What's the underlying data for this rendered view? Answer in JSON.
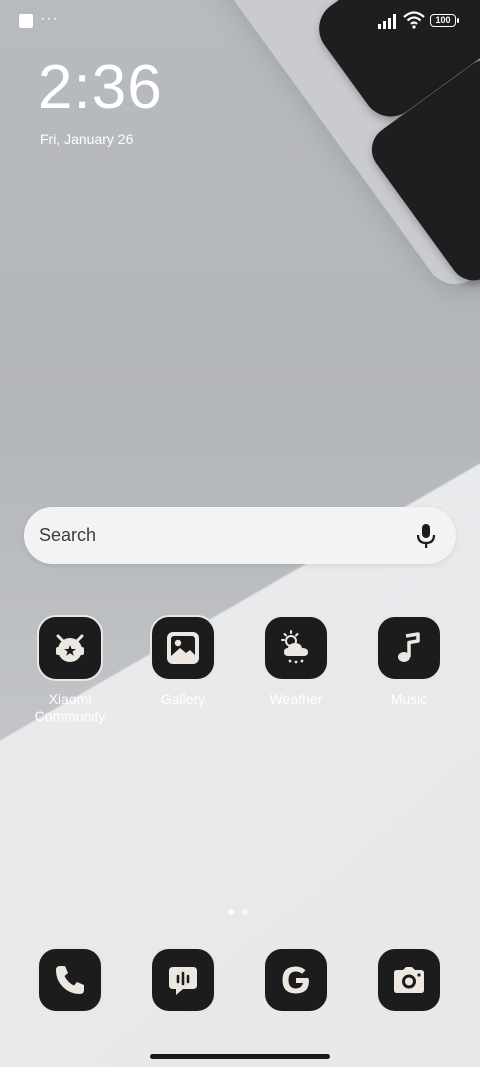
{
  "status_bar": {
    "more": "···",
    "battery": "100"
  },
  "clock": {
    "time": "2:36",
    "date": "Fri, January 26"
  },
  "search": {
    "placeholder": "Search"
  },
  "apps": [
    {
      "label": "Xiaomi Community",
      "icon": "xiaomi-community-icon"
    },
    {
      "label": "Gallery",
      "icon": "gallery-icon"
    },
    {
      "label": "Weather",
      "icon": "weather-icon"
    },
    {
      "label": "Music",
      "icon": "music-icon"
    }
  ],
  "dock": [
    {
      "icon": "phone-icon"
    },
    {
      "icon": "messages-icon"
    },
    {
      "icon": "google-icon"
    },
    {
      "icon": "camera-icon"
    }
  ],
  "pager": {
    "total": 2,
    "current": 1
  },
  "colors": {
    "icon_bg": "#1c1c1d",
    "icon_border": "#e7e7e8",
    "search_bg": "#f3f3f4"
  }
}
